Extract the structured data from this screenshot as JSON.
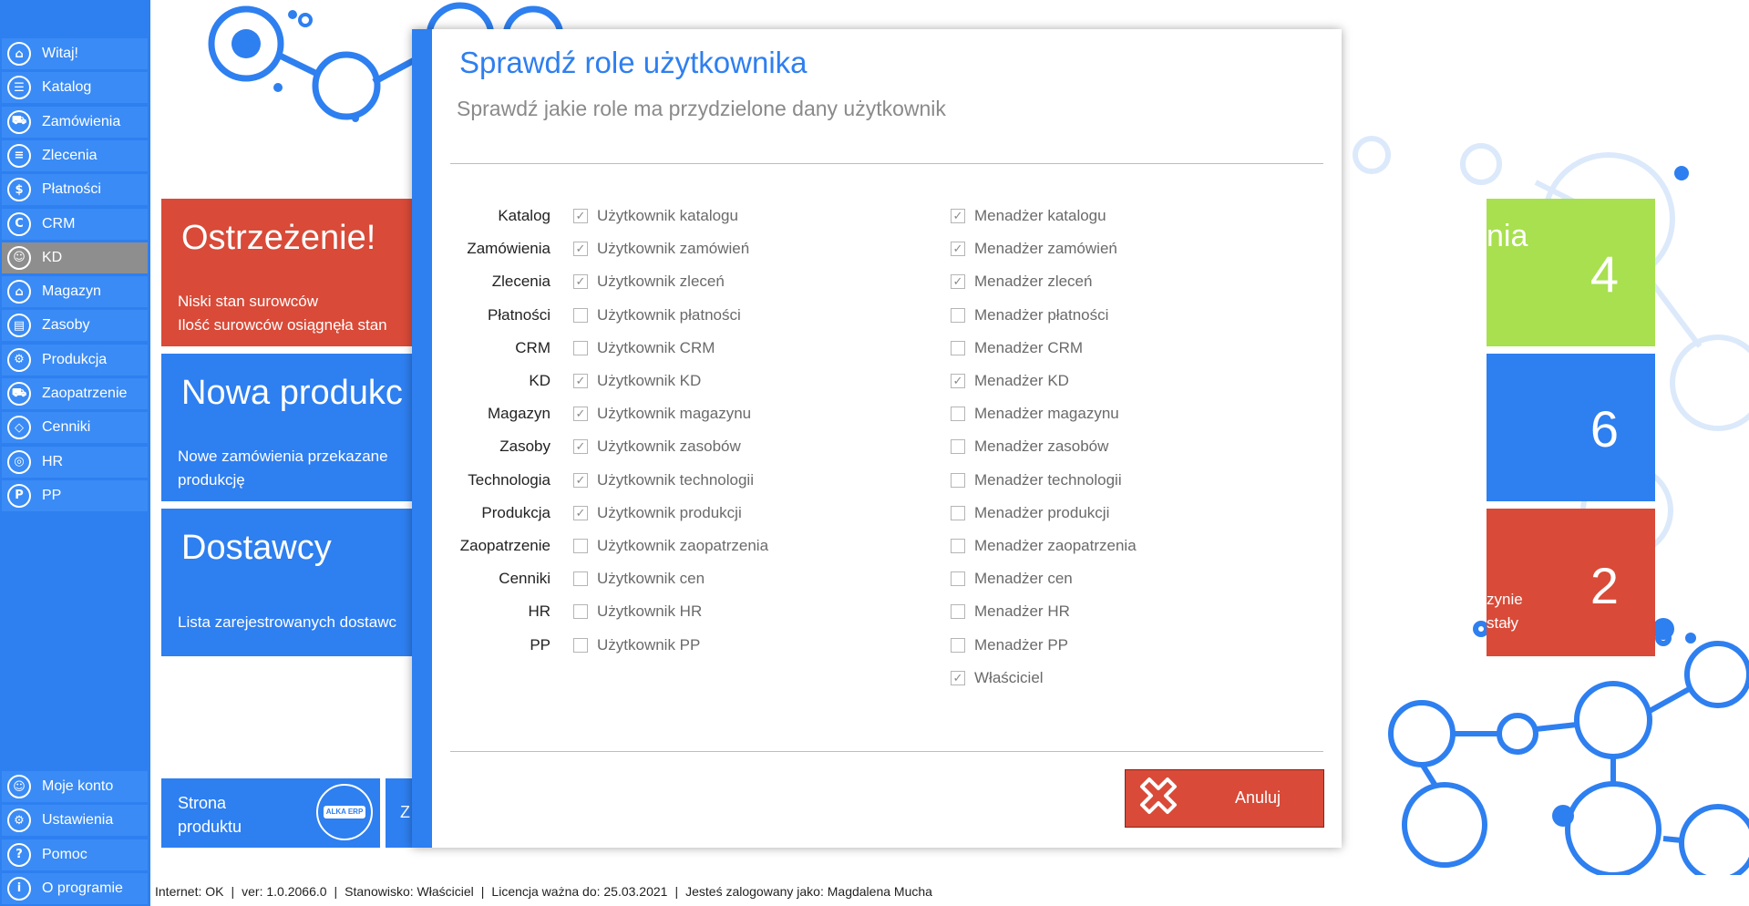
{
  "sidebar": {
    "items": [
      {
        "label": "Witaj!",
        "icon": "home-icon"
      },
      {
        "label": "Katalog",
        "icon": "book-icon"
      },
      {
        "label": "Zamówienia",
        "icon": "cart-icon"
      },
      {
        "label": "Zlecenia",
        "icon": "list-icon"
      },
      {
        "label": "Płatności",
        "icon": "dollar-icon"
      },
      {
        "label": "CRM",
        "icon": "crm-icon"
      },
      {
        "label": "KD",
        "icon": "user-lock-icon"
      },
      {
        "label": "Magazyn",
        "icon": "warehouse-icon"
      },
      {
        "label": "Zasoby",
        "icon": "resources-icon"
      },
      {
        "label": "Produkcja",
        "icon": "production-icon"
      },
      {
        "label": "Zaopatrzenie",
        "icon": "truck-icon"
      },
      {
        "label": "Cenniki",
        "icon": "tag-icon"
      },
      {
        "label": "HR",
        "icon": "hr-icon"
      },
      {
        "label": "PP",
        "icon": "pp-icon"
      }
    ],
    "bottom_items": [
      {
        "label": "Moje konto",
        "icon": "account-icon"
      },
      {
        "label": "Ustawienia",
        "icon": "settings-icon"
      },
      {
        "label": "Pomoc",
        "icon": "help-icon"
      },
      {
        "label": "O programie",
        "icon": "info-icon"
      }
    ],
    "active_item": "KD"
  },
  "tiles": {
    "warning": {
      "title": "Ostrzeżenie!",
      "desc_line1": "Niski stan surowców",
      "desc_line2": "Ilość surowców osiągnęła stan"
    },
    "new_production": {
      "title": "Nowa produkc",
      "desc_line1": "Nowe zamówienia przekazane",
      "desc_line2": "produkcję"
    },
    "suppliers": {
      "title": "Dostawcy",
      "desc_line1": "Lista zarejestrowanych dostawc"
    },
    "product_page": {
      "line1": "Strona",
      "line2": "produktu",
      "logo_text": "ALKA ERP"
    },
    "next_tile": {
      "text": "Z"
    }
  },
  "right_tiles": [
    {
      "title_fragment": "nia",
      "number": "4",
      "color": "#a8e04f"
    },
    {
      "number": "6",
      "color": "#2e7ff0"
    },
    {
      "desc_line1": "zynie",
      "desc_line2": "stały",
      "number": "2",
      "color": "#d94a38"
    }
  ],
  "modal": {
    "title": "Sprawdź role użytkownika",
    "subtitle": "Sprawdź jakie role ma przydzielone dany użytkownik",
    "rows": [
      {
        "module": "Katalog",
        "user_role": "Użytkownik katalogu",
        "user_checked": true,
        "manager_role": "Menadżer katalogu",
        "manager_checked": true
      },
      {
        "module": "Zamówienia",
        "user_role": "Użytkownik zamówień",
        "user_checked": true,
        "manager_role": "Menadżer zamówień",
        "manager_checked": true
      },
      {
        "module": "Zlecenia",
        "user_role": "Użytkownik zleceń",
        "user_checked": true,
        "manager_role": "Menadżer zleceń",
        "manager_checked": true
      },
      {
        "module": "Płatności",
        "user_role": "Użytkownik płatności",
        "user_checked": false,
        "manager_role": "Menadżer płatności",
        "manager_checked": false
      },
      {
        "module": "CRM",
        "user_role": "Użytkownik CRM",
        "user_checked": false,
        "manager_role": "Menadżer CRM",
        "manager_checked": false
      },
      {
        "module": "KD",
        "user_role": "Użytkownik KD",
        "user_checked": true,
        "manager_role": "Menadżer KD",
        "manager_checked": true
      },
      {
        "module": "Magazyn",
        "user_role": "Użytkownik magazynu",
        "user_checked": true,
        "manager_role": "Menadżer magazynu",
        "manager_checked": false
      },
      {
        "module": "Zasoby",
        "user_role": "Użytkownik zasobów",
        "user_checked": true,
        "manager_role": "Menadżer zasobów",
        "manager_checked": false
      },
      {
        "module": "Technologia",
        "user_role": "Użytkownik technologii",
        "user_checked": true,
        "manager_role": "Menadżer technologii",
        "manager_checked": false
      },
      {
        "module": "Produkcja",
        "user_role": "Użytkownik produkcji",
        "user_checked": true,
        "manager_role": "Menadżer produkcji",
        "manager_checked": false
      },
      {
        "module": "Zaopatrzenie",
        "user_role": "Użytkownik zaopatrzenia",
        "user_checked": false,
        "manager_role": "Menadżer zaopatrzenia",
        "manager_checked": false
      },
      {
        "module": "Cenniki",
        "user_role": "Użytkownik cen",
        "user_checked": false,
        "manager_role": "Menadżer cen",
        "manager_checked": false
      },
      {
        "module": "HR",
        "user_role": "Użytkownik HR",
        "user_checked": false,
        "manager_role": "Menadżer HR",
        "manager_checked": false
      },
      {
        "module": "PP",
        "user_role": "Użytkownik PP",
        "user_checked": false,
        "manager_role": "Menadżer PP",
        "manager_checked": false
      }
    ],
    "owner": {
      "label": "Właściciel",
      "checked": true
    },
    "cancel_label": "Anuluj"
  },
  "statusbar": {
    "internet": "Internet: OK",
    "version": "ver: 1.0.2066.0",
    "station": "Stanowisko: Właściciel",
    "license": "Licencja ważna do: 25.03.2021",
    "logged_in": "Jesteś zalogowany jako: Magdalena Mucha"
  },
  "colors": {
    "accent": "#2e7ff0",
    "danger": "#d94a38",
    "success": "#a8e04f"
  }
}
